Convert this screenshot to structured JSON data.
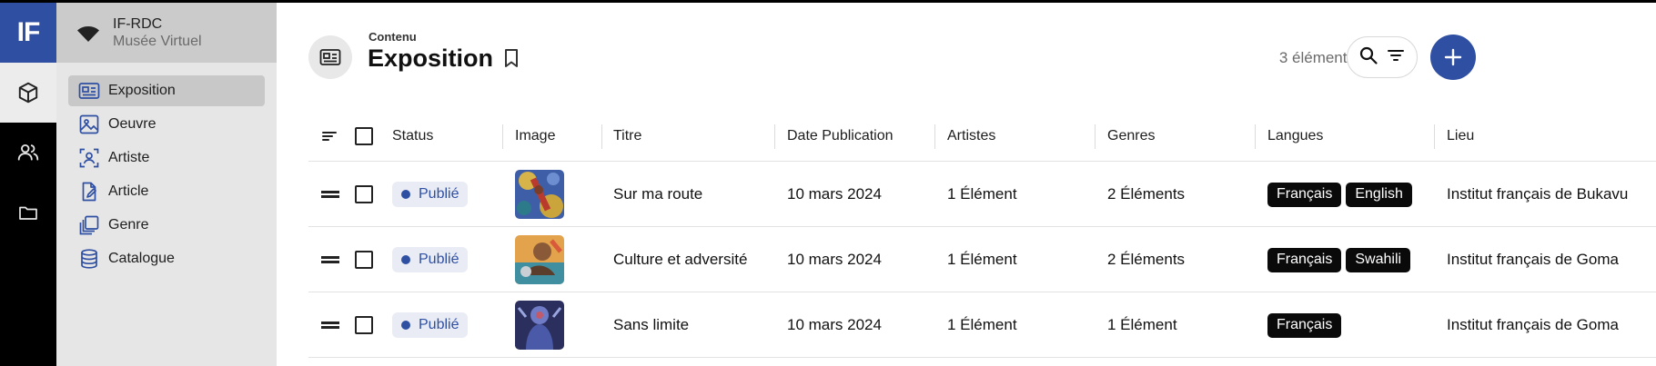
{
  "app": {
    "logo_text": "IF",
    "org_name": "IF-RDC",
    "site_name": "Musée Virtuel"
  },
  "rail": {
    "items": [
      {
        "icon": "cube-icon",
        "active": true
      },
      {
        "icon": "users-icon",
        "active": false
      },
      {
        "icon": "folder-icon",
        "active": false
      }
    ]
  },
  "sidebar": {
    "items": [
      {
        "label": "Exposition",
        "icon": "exhibition-icon",
        "active": true
      },
      {
        "label": "Oeuvre",
        "icon": "image-icon",
        "active": false
      },
      {
        "label": "Artiste",
        "icon": "artist-icon",
        "active": false
      },
      {
        "label": "Article",
        "icon": "article-icon",
        "active": false
      },
      {
        "label": "Genre",
        "icon": "genre-icon",
        "active": false
      },
      {
        "label": "Catalogue",
        "icon": "database-icon",
        "active": false
      }
    ]
  },
  "header": {
    "breadcrumb": "Contenu",
    "title": "Exposition",
    "count": "3 éléments"
  },
  "table": {
    "columns": {
      "status": "Status",
      "image": "Image",
      "titre": "Titre",
      "date": "Date Publication",
      "artistes": "Artistes",
      "genres": "Genres",
      "langues": "Langues",
      "lieu": "Lieu"
    },
    "rows": [
      {
        "status": "Publié",
        "titre": "Sur ma route",
        "date": "10 mars 2024",
        "artistes": "1 Élément",
        "genres": "2 Éléments",
        "langues": [
          "Français",
          "English"
        ],
        "lieu": "Institut français de Bukavu"
      },
      {
        "status": "Publié",
        "titre": "Culture et adversité",
        "date": "10 mars 2024",
        "artistes": "1 Élément",
        "genres": "2 Éléments",
        "langues": [
          "Français",
          "Swahili"
        ],
        "lieu": "Institut français de Goma"
      },
      {
        "status": "Publié",
        "titre": "Sans limite",
        "date": "10 mars 2024",
        "artistes": "1 Élément",
        "genres": "1 Élément",
        "langues": [
          "Français"
        ],
        "lieu": "Institut français de Goma"
      }
    ]
  },
  "colors": {
    "accent": "#2f4fa2",
    "rail": "#000000",
    "sidebar": "#e6e6e6",
    "tag": "#0a0a0a"
  }
}
